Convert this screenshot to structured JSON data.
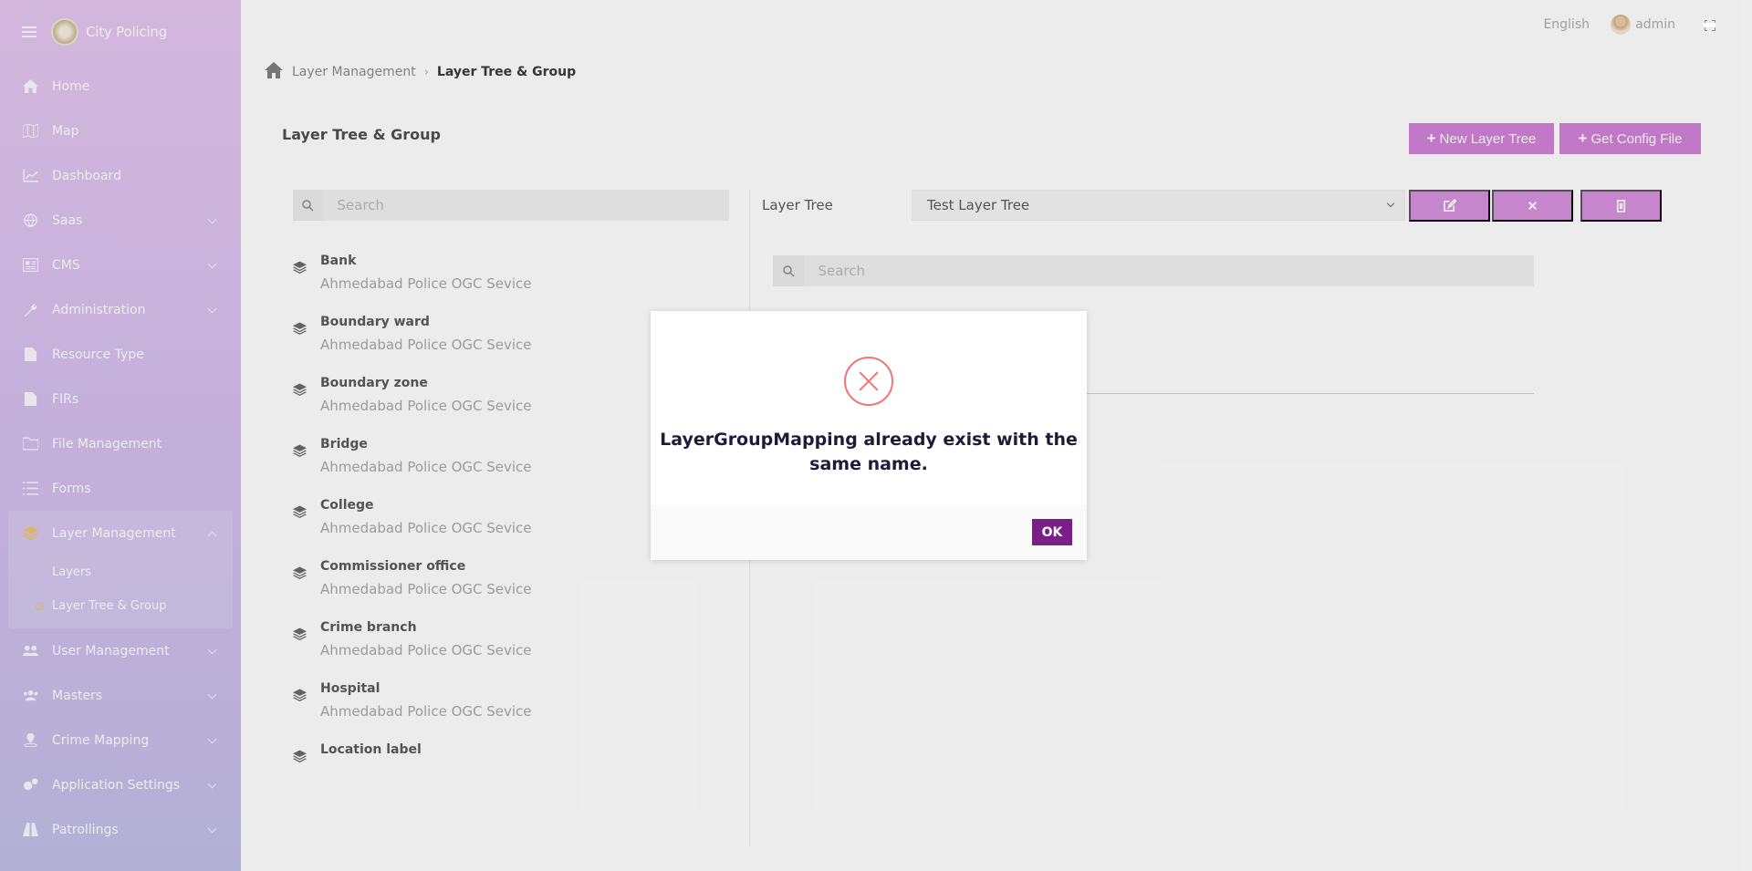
{
  "app": {
    "name": "City Policing"
  },
  "header": {
    "language": "English",
    "user": "admin"
  },
  "sidebar": {
    "items": [
      {
        "label": "Home"
      },
      {
        "label": "Map"
      },
      {
        "label": "Dashboard"
      },
      {
        "label": "Saas"
      },
      {
        "label": "CMS"
      },
      {
        "label": "Administration"
      },
      {
        "label": "Resource Type"
      },
      {
        "label": "FIRs"
      },
      {
        "label": "File Management"
      },
      {
        "label": "Forms"
      },
      {
        "label": "Layer Management"
      },
      {
        "label": "User Management"
      },
      {
        "label": "Masters"
      },
      {
        "label": "Crime Mapping"
      },
      {
        "label": "Application Settings"
      },
      {
        "label": "Patrollings"
      }
    ],
    "layer_submenu": [
      {
        "label": "Layers"
      },
      {
        "label": "Layer Tree & Group"
      }
    ]
  },
  "breadcrumb": {
    "parent": "Layer Management",
    "current": "Layer Tree & Group"
  },
  "page": {
    "title": "Layer Tree & Group",
    "new_tree_label": "New Layer Tree",
    "config_label": "Get Config File",
    "search_placeholder": "Search",
    "layer_tree_label": "Layer Tree",
    "layer_tree_value": "Test Layer Tree",
    "tree_search_placeholder": "Search"
  },
  "layers": [
    {
      "name": "Bank",
      "source": "Ahmedabad Police OGC Sevice"
    },
    {
      "name": "Boundary ward",
      "source": "Ahmedabad Police OGC Sevice"
    },
    {
      "name": "Boundary zone",
      "source": "Ahmedabad Police OGC Sevice"
    },
    {
      "name": "Bridge",
      "source": "Ahmedabad Police OGC Sevice"
    },
    {
      "name": "College",
      "source": "Ahmedabad Police OGC Sevice"
    },
    {
      "name": "Commissioner office",
      "source": "Ahmedabad Police OGC Sevice"
    },
    {
      "name": "Crime branch",
      "source": "Ahmedabad Police OGC Sevice"
    },
    {
      "name": "Hospital",
      "source": "Ahmedabad Police OGC Sevice"
    },
    {
      "name": "Location label",
      "source": ""
    }
  ],
  "modal": {
    "message": "LayerGroupMapping already exist with the same name.",
    "ok_label": "OK"
  },
  "colors": {
    "accent": "#cf7dd6",
    "ok_button": "#7a1f86",
    "error": "#f27474"
  }
}
